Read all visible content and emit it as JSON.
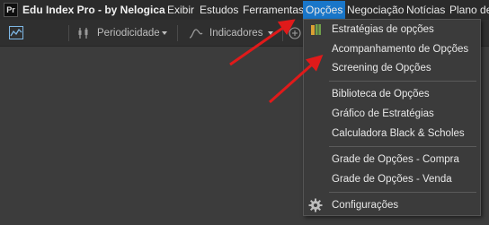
{
  "app": {
    "icon_text": "Pr",
    "title": "Edu Index Pro - by Nelogica"
  },
  "menubar": {
    "items": [
      {
        "label": "Exibir"
      },
      {
        "label": "Estudos"
      },
      {
        "label": "Ferramentas"
      },
      {
        "label": "Opções"
      },
      {
        "label": "Negociação"
      },
      {
        "label": "Notícias"
      },
      {
        "label": "Plano de"
      }
    ]
  },
  "toolbar": {
    "periodicity": "Periodicidade",
    "indicators": "Indicadores"
  },
  "options_menu": {
    "items": [
      {
        "label": "Estratégias de opções"
      },
      {
        "label": "Acompanhamento de Opções"
      },
      {
        "label": "Screening de Opções"
      },
      {
        "label": "Biblioteca de Opções"
      },
      {
        "label": "Gráfico de Estratégias"
      },
      {
        "label": "Calculadora Black & Scholes"
      },
      {
        "label": "Grade de Opções - Compra"
      },
      {
        "label": "Grade de Opções - Venda"
      },
      {
        "label": "Configurações"
      }
    ]
  },
  "colors": {
    "menu_active": "#1976c9",
    "annotation_arrow": "#e01a1a"
  }
}
